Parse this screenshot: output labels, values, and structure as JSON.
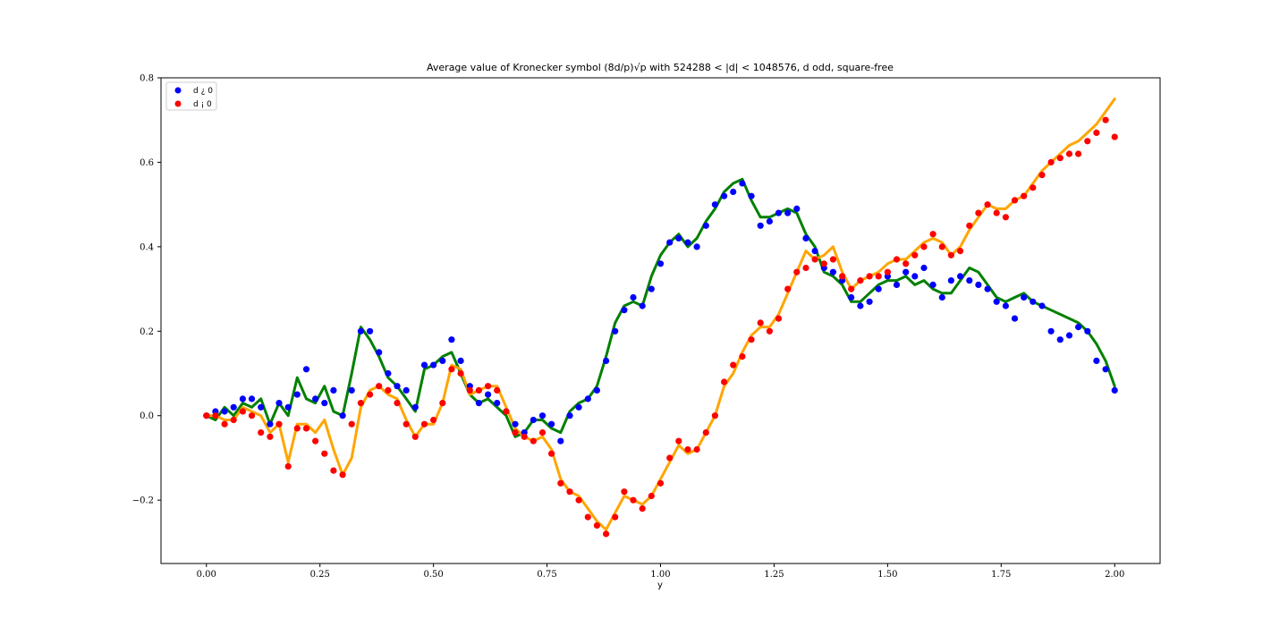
{
  "chart_data": {
    "type": "scatter",
    "title": "Average value of Kronecker symbol (8d/p)√p with 524288 < |d| < 1048576, d odd, square-free",
    "xlabel": "y",
    "ylabel": "",
    "xlim": [
      -0.1,
      2.1
    ],
    "ylim": [
      -0.35,
      0.8
    ],
    "xticks": [
      "0.00",
      "0.25",
      "0.50",
      "0.75",
      "1.00",
      "1.25",
      "1.50",
      "1.75",
      "2.00"
    ],
    "yticks": [
      "−0.2",
      "0.0",
      "0.2",
      "0.4",
      "0.6",
      "0.8"
    ],
    "grid": false,
    "legend": {
      "position": "top-left"
    },
    "series": [
      {
        "name": "d ¿ 0",
        "kind": "scatter",
        "color": "#0000ff",
        "x": [
          0.0,
          0.02,
          0.04,
          0.06,
          0.08,
          0.1,
          0.12,
          0.14,
          0.16,
          0.18,
          0.2,
          0.22,
          0.24,
          0.26,
          0.28,
          0.3,
          0.32,
          0.34,
          0.36,
          0.38,
          0.4,
          0.42,
          0.44,
          0.46,
          0.48,
          0.5,
          0.52,
          0.54,
          0.56,
          0.58,
          0.6,
          0.62,
          0.64,
          0.66,
          0.68,
          0.7,
          0.72,
          0.74,
          0.76,
          0.78,
          0.8,
          0.82,
          0.84,
          0.86,
          0.88,
          0.9,
          0.92,
          0.94,
          0.96,
          0.98,
          1.0,
          1.02,
          1.04,
          1.06,
          1.08,
          1.1,
          1.12,
          1.14,
          1.16,
          1.18,
          1.2,
          1.22,
          1.24,
          1.26,
          1.28,
          1.3,
          1.32,
          1.34,
          1.36,
          1.38,
          1.4,
          1.42,
          1.44,
          1.46,
          1.48,
          1.5,
          1.52,
          1.54,
          1.56,
          1.58,
          1.6,
          1.62,
          1.64,
          1.66,
          1.68,
          1.7,
          1.72,
          1.74,
          1.76,
          1.78,
          1.8,
          1.82,
          1.84,
          1.86,
          1.88,
          1.9,
          1.92,
          1.94,
          1.96,
          1.98,
          2.0
        ],
        "y": [
          0.0,
          0.01,
          0.01,
          0.02,
          0.04,
          0.04,
          0.02,
          -0.02,
          0.03,
          0.02,
          0.05,
          0.11,
          0.04,
          0.03,
          0.06,
          0.0,
          0.06,
          0.2,
          0.2,
          0.15,
          0.1,
          0.07,
          0.06,
          0.02,
          0.12,
          0.12,
          0.13,
          0.18,
          0.13,
          0.07,
          0.03,
          0.05,
          0.03,
          0.01,
          -0.02,
          -0.04,
          -0.01,
          0.0,
          -0.02,
          -0.06,
          0.0,
          0.02,
          0.04,
          0.06,
          0.13,
          0.2,
          0.25,
          0.28,
          0.26,
          0.3,
          0.36,
          0.41,
          0.42,
          0.41,
          0.4,
          0.45,
          0.5,
          0.52,
          0.53,
          0.55,
          0.52,
          0.45,
          0.46,
          0.48,
          0.48,
          0.49,
          0.42,
          0.39,
          0.35,
          0.34,
          0.32,
          0.28,
          0.26,
          0.27,
          0.3,
          0.33,
          0.31,
          0.34,
          0.33,
          0.35,
          0.31,
          0.28,
          0.32,
          0.33,
          0.32,
          0.31,
          0.3,
          0.27,
          0.26,
          0.23,
          0.28,
          0.27,
          0.26,
          0.2,
          0.18,
          0.19,
          0.21,
          0.2,
          0.13,
          0.11,
          0.06
        ]
      },
      {
        "name": "d ¡ 0",
        "kind": "scatter",
        "color": "#ff0000",
        "x": [
          0.0,
          0.02,
          0.04,
          0.06,
          0.08,
          0.1,
          0.12,
          0.14,
          0.16,
          0.18,
          0.2,
          0.22,
          0.24,
          0.26,
          0.28,
          0.3,
          0.32,
          0.34,
          0.36,
          0.38,
          0.4,
          0.42,
          0.44,
          0.46,
          0.48,
          0.5,
          0.52,
          0.54,
          0.56,
          0.58,
          0.6,
          0.62,
          0.64,
          0.66,
          0.68,
          0.7,
          0.72,
          0.74,
          0.76,
          0.78,
          0.8,
          0.82,
          0.84,
          0.86,
          0.88,
          0.9,
          0.92,
          0.94,
          0.96,
          0.98,
          1.0,
          1.02,
          1.04,
          1.06,
          1.08,
          1.1,
          1.12,
          1.14,
          1.16,
          1.18,
          1.2,
          1.22,
          1.24,
          1.26,
          1.28,
          1.3,
          1.32,
          1.34,
          1.36,
          1.38,
          1.4,
          1.42,
          1.44,
          1.46,
          1.48,
          1.5,
          1.52,
          1.54,
          1.56,
          1.58,
          1.6,
          1.62,
          1.64,
          1.66,
          1.68,
          1.7,
          1.72,
          1.74,
          1.76,
          1.78,
          1.8,
          1.82,
          1.84,
          1.86,
          1.88,
          1.9,
          1.92,
          1.94,
          1.96,
          1.98,
          2.0
        ],
        "y": [
          0.0,
          0.0,
          -0.02,
          -0.01,
          0.01,
          0.0,
          -0.04,
          -0.05,
          -0.02,
          -0.12,
          -0.03,
          -0.03,
          -0.06,
          -0.09,
          -0.13,
          -0.14,
          -0.02,
          0.03,
          0.05,
          0.07,
          0.06,
          0.03,
          -0.02,
          -0.05,
          -0.02,
          -0.01,
          0.03,
          0.11,
          0.1,
          0.06,
          0.06,
          0.07,
          0.06,
          0.01,
          -0.04,
          -0.05,
          -0.06,
          -0.04,
          -0.09,
          -0.16,
          -0.18,
          -0.2,
          -0.24,
          -0.26,
          -0.28,
          -0.24,
          -0.18,
          -0.2,
          -0.22,
          -0.19,
          -0.16,
          -0.1,
          -0.06,
          -0.08,
          -0.08,
          -0.04,
          0.0,
          0.08,
          0.12,
          0.14,
          0.18,
          0.22,
          0.2,
          0.23,
          0.3,
          0.34,
          0.35,
          0.37,
          0.36,
          0.37,
          0.33,
          0.3,
          0.32,
          0.33,
          0.33,
          0.34,
          0.37,
          0.36,
          0.38,
          0.4,
          0.43,
          0.4,
          0.38,
          0.39,
          0.45,
          0.48,
          0.5,
          0.48,
          0.47,
          0.51,
          0.52,
          0.54,
          0.57,
          0.6,
          0.61,
          0.62,
          0.62,
          0.65,
          0.67,
          0.7,
          0.66
        ]
      },
      {
        "name": "",
        "kind": "line",
        "color": "#008000",
        "x": [
          0.0,
          0.02,
          0.04,
          0.06,
          0.08,
          0.1,
          0.12,
          0.14,
          0.16,
          0.18,
          0.2,
          0.22,
          0.24,
          0.26,
          0.28,
          0.3,
          0.32,
          0.34,
          0.36,
          0.38,
          0.4,
          0.42,
          0.44,
          0.46,
          0.48,
          0.5,
          0.52,
          0.54,
          0.56,
          0.58,
          0.6,
          0.62,
          0.64,
          0.66,
          0.68,
          0.7,
          0.72,
          0.74,
          0.76,
          0.78,
          0.8,
          0.82,
          0.84,
          0.86,
          0.88,
          0.9,
          0.92,
          0.94,
          0.96,
          0.98,
          1.0,
          1.02,
          1.04,
          1.06,
          1.08,
          1.1,
          1.12,
          1.14,
          1.16,
          1.18,
          1.2,
          1.22,
          1.24,
          1.26,
          1.28,
          1.3,
          1.32,
          1.34,
          1.36,
          1.38,
          1.4,
          1.42,
          1.44,
          1.46,
          1.48,
          1.5,
          1.52,
          1.54,
          1.56,
          1.58,
          1.6,
          1.62,
          1.64,
          1.66,
          1.68,
          1.7,
          1.72,
          1.74,
          1.76,
          1.78,
          1.8,
          1.82,
          1.84,
          1.86,
          1.88,
          1.9,
          1.92,
          1.94,
          1.96,
          1.98,
          2.0
        ],
        "y": [
          0.0,
          -0.01,
          0.02,
          0.0,
          0.03,
          0.02,
          0.04,
          -0.02,
          0.03,
          0.0,
          0.09,
          0.04,
          0.03,
          0.07,
          0.01,
          0.0,
          0.1,
          0.21,
          0.18,
          0.14,
          0.09,
          0.07,
          0.04,
          0.01,
          0.11,
          0.12,
          0.14,
          0.15,
          0.1,
          0.05,
          0.03,
          0.04,
          0.02,
          0.0,
          -0.05,
          -0.04,
          -0.01,
          -0.01,
          -0.03,
          -0.04,
          0.01,
          0.03,
          0.04,
          0.07,
          0.14,
          0.22,
          0.26,
          0.27,
          0.26,
          0.33,
          0.38,
          0.41,
          0.43,
          0.4,
          0.42,
          0.46,
          0.49,
          0.53,
          0.55,
          0.56,
          0.51,
          0.47,
          0.47,
          0.48,
          0.49,
          0.48,
          0.43,
          0.4,
          0.34,
          0.33,
          0.31,
          0.27,
          0.27,
          0.29,
          0.31,
          0.32,
          0.32,
          0.33,
          0.31,
          0.32,
          0.3,
          0.29,
          0.29,
          0.32,
          0.35,
          0.34,
          0.31,
          0.28,
          0.27,
          0.28,
          0.29,
          0.27,
          0.26,
          0.25,
          0.24,
          0.23,
          0.22,
          0.2,
          0.17,
          0.13,
          0.07
        ]
      },
      {
        "name": "",
        "kind": "line",
        "color": "#ffa500",
        "x": [
          0.0,
          0.02,
          0.04,
          0.06,
          0.08,
          0.1,
          0.12,
          0.14,
          0.16,
          0.18,
          0.2,
          0.22,
          0.24,
          0.26,
          0.28,
          0.3,
          0.32,
          0.34,
          0.36,
          0.38,
          0.4,
          0.42,
          0.44,
          0.46,
          0.48,
          0.5,
          0.52,
          0.54,
          0.56,
          0.58,
          0.6,
          0.62,
          0.64,
          0.66,
          0.68,
          0.7,
          0.72,
          0.74,
          0.76,
          0.78,
          0.8,
          0.82,
          0.84,
          0.86,
          0.88,
          0.9,
          0.92,
          0.94,
          0.96,
          0.98,
          1.0,
          1.02,
          1.04,
          1.06,
          1.08,
          1.1,
          1.12,
          1.14,
          1.16,
          1.18,
          1.2,
          1.22,
          1.24,
          1.26,
          1.28,
          1.3,
          1.32,
          1.34,
          1.36,
          1.38,
          1.4,
          1.42,
          1.44,
          1.46,
          1.48,
          1.5,
          1.52,
          1.54,
          1.56,
          1.58,
          1.6,
          1.62,
          1.64,
          1.66,
          1.68,
          1.7,
          1.72,
          1.74,
          1.76,
          1.78,
          1.8,
          1.82,
          1.84,
          1.86,
          1.88,
          1.9,
          1.92,
          1.94,
          1.96,
          1.98,
          2.0
        ],
        "y": [
          0.0,
          0.0,
          -0.01,
          -0.01,
          0.02,
          0.01,
          0.0,
          -0.04,
          -0.02,
          -0.11,
          -0.02,
          -0.02,
          -0.04,
          -0.01,
          -0.08,
          -0.14,
          -0.1,
          0.02,
          0.06,
          0.07,
          0.05,
          0.04,
          -0.01,
          -0.05,
          -0.02,
          -0.02,
          0.03,
          0.12,
          0.11,
          0.05,
          0.06,
          0.07,
          0.07,
          0.02,
          -0.03,
          -0.05,
          -0.06,
          -0.05,
          -0.08,
          -0.15,
          -0.18,
          -0.19,
          -0.22,
          -0.25,
          -0.27,
          -0.23,
          -0.19,
          -0.2,
          -0.21,
          -0.19,
          -0.15,
          -0.11,
          -0.07,
          -0.09,
          -0.08,
          -0.04,
          0.0,
          0.07,
          0.1,
          0.15,
          0.19,
          0.21,
          0.21,
          0.24,
          0.29,
          0.34,
          0.39,
          0.37,
          0.38,
          0.4,
          0.34,
          0.3,
          0.32,
          0.33,
          0.34,
          0.36,
          0.37,
          0.37,
          0.39,
          0.41,
          0.42,
          0.41,
          0.38,
          0.4,
          0.44,
          0.47,
          0.5,
          0.49,
          0.49,
          0.51,
          0.52,
          0.55,
          0.58,
          0.6,
          0.62,
          0.64,
          0.65,
          0.67,
          0.69,
          0.72,
          0.75
        ]
      }
    ]
  }
}
